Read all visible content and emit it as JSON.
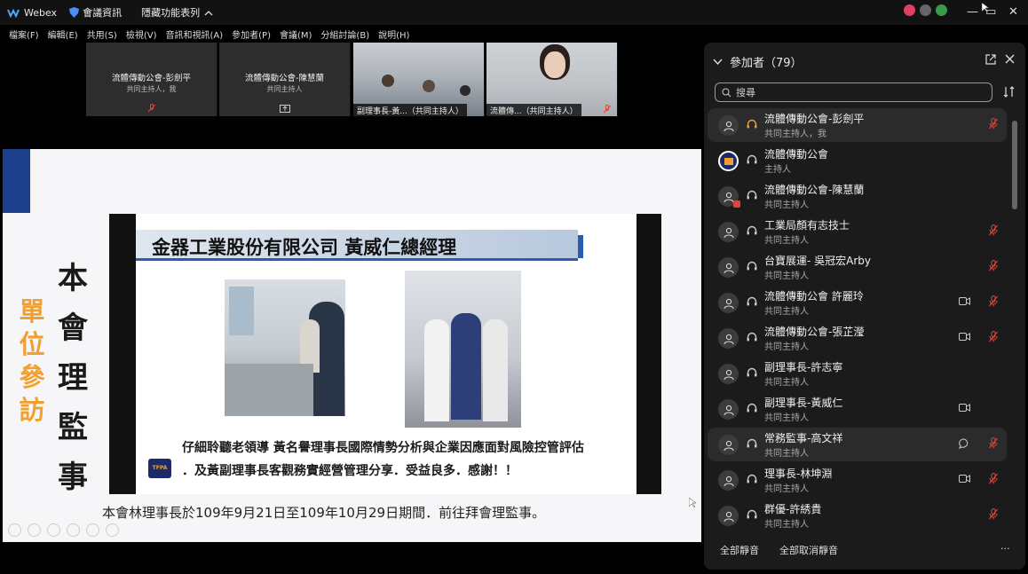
{
  "titlebar": {
    "app": "Webex",
    "meeting_info": "會議資訊",
    "hide_menu": "隱藏功能表列"
  },
  "menu": [
    "檔案(F)",
    "編輯(E)",
    "共用(S)",
    "檢視(V)",
    "音訊和視訊(A)",
    "參加者(P)",
    "會議(M)",
    "分組討論(B)",
    "說明(H)"
  ],
  "thumbs": [
    {
      "name": "流體傳動公會-彭劍平",
      "role": "共同主持人，我"
    },
    {
      "name": "流體傳動公會-陳慧蘭",
      "role": "共同主持人"
    },
    {
      "label": "副理事長-黃...（共同主持人）"
    },
    {
      "label": "流體傳...（共同主持人）"
    }
  ],
  "slide": {
    "vertical_left": [
      "單",
      "位",
      "參",
      "訪"
    ],
    "vertical_right": [
      "本",
      "會",
      "理",
      "監",
      "事"
    ],
    "banner": "金器工業股份有限公司 黃威仁總經理",
    "line1": "仔細聆聽老領導 黃名譽理事長國際情勢分析與企業因應面對風險控管評估",
    "line2": "．及黃副理事長客觀務實經營管理分享．受益良多．感謝！！",
    "caption": "本會林理事長於109年9月21日至109年10月29日期間．前往拜會理監事。",
    "logo_text": "TFPA"
  },
  "panel": {
    "title": "參加者（79）",
    "search_placeholder": "搜尋",
    "participants": [
      {
        "name": "流體傳動公會-彭劍平",
        "role": "共同主持人，我"
      },
      {
        "name": "流體傳動公會",
        "role": "主持人"
      },
      {
        "name": "流體傳動公會-陳慧蘭",
        "role": "共同主持人"
      },
      {
        "name": "工業局顏有志技士",
        "role": "共同主持人"
      },
      {
        "name": "台寶展運- 吳冠宏Arby",
        "role": "共同主持人"
      },
      {
        "name": "流體傳動公會 許麗玲",
        "role": "共同主持人"
      },
      {
        "name": "流體傳動公會-張芷瀅",
        "role": "共同主持人"
      },
      {
        "name": "副理事長-許志寧",
        "role": "共同主持人"
      },
      {
        "name": "副理事長-黃威仁",
        "role": "共同主持人"
      },
      {
        "name": "常務監事-高文祥",
        "role": "共同主持人"
      },
      {
        "name": "理事長-林坤淵",
        "role": "共同主持人"
      },
      {
        "name": "群優-許綉貴",
        "role": "共同主持人"
      }
    ],
    "mute_all": "全部靜音",
    "unmute_all": "全部取消靜音",
    "more": "···"
  },
  "colors": {
    "accent_orange": "#f0a030",
    "navy": "#1d3f8c",
    "muted_red": "#e0453a",
    "panel_bg": "#1b1b1b"
  }
}
